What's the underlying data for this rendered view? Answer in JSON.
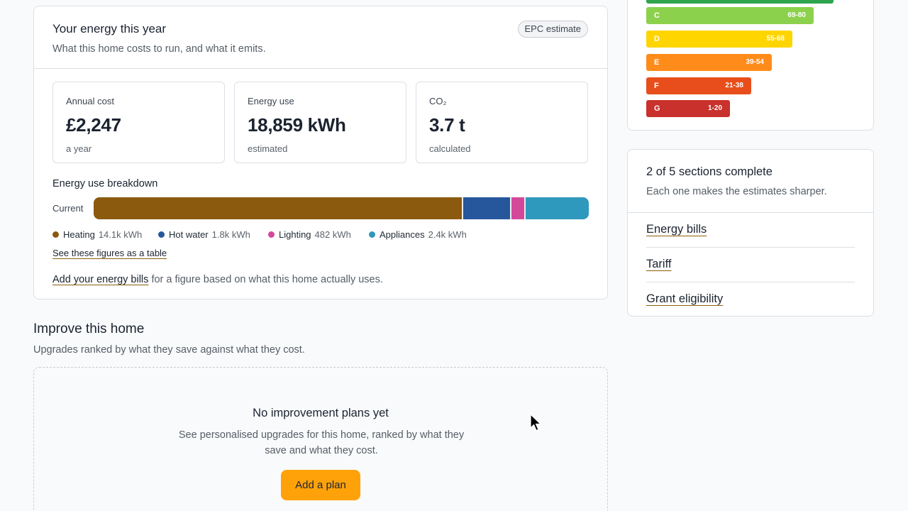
{
  "energy": {
    "title": "Your energy this year",
    "subtitle": "What this home costs to run, and what it emits.",
    "badge": "EPC estimate",
    "stats": [
      {
        "label": "Annual cost",
        "value": "£2,247",
        "note": "a year"
      },
      {
        "label": "Energy use",
        "value": "18,859 kWh",
        "note": "estimated"
      },
      {
        "label": "CO₂",
        "value": "3.7 t",
        "note": "calculated"
      }
    ],
    "breakdown": {
      "title": "Energy use breakdown",
      "row_label": "Current",
      "items": [
        {
          "name": "Heating",
          "value": "14.1k kWh",
          "kwh": 14100,
          "color": "#8b5a0f"
        },
        {
          "name": "Hot water",
          "value": "1.8k kWh",
          "kwh": 1800,
          "color": "#26579c"
        },
        {
          "name": "Lighting",
          "value": "482 kWh",
          "kwh": 482,
          "color": "#d4489c"
        },
        {
          "name": "Appliances",
          "value": "2.4k kWh",
          "kwh": 2400,
          "color": "#2f98bd"
        }
      ]
    },
    "table_link": "See these figures as a table",
    "bills_link": "Add your energy bills",
    "bills_text": " for a figure based on what this home actually uses."
  },
  "improve": {
    "title": "Improve this home",
    "subtitle": "Upgrades ranked by what they save against what they cost.",
    "empty_title": "No improvement plans yet",
    "empty_text": "See personalised upgrades for this home, ranked by what they save and what they cost.",
    "button": "Add a plan"
  },
  "epc": {
    "bands": [
      {
        "letter": "",
        "range": "",
        "color": "#2ea44f"
      },
      {
        "letter": "C",
        "range": "69-80",
        "color": "#8cd14c"
      },
      {
        "letter": "D",
        "range": "55-68",
        "color": "#ffd500"
      },
      {
        "letter": "E",
        "range": "39-54",
        "color": "#ff8c1a"
      },
      {
        "letter": "F",
        "range": "21-38",
        "color": "#e84e1b"
      },
      {
        "letter": "G",
        "range": "1-20",
        "color": "#c9312c"
      }
    ]
  },
  "progress": {
    "title": "2 of 5 sections complete",
    "subtitle": "Each one makes the estimates sharper.",
    "links": [
      "Energy bills",
      "Tariff",
      "Grant eligibility"
    ]
  }
}
